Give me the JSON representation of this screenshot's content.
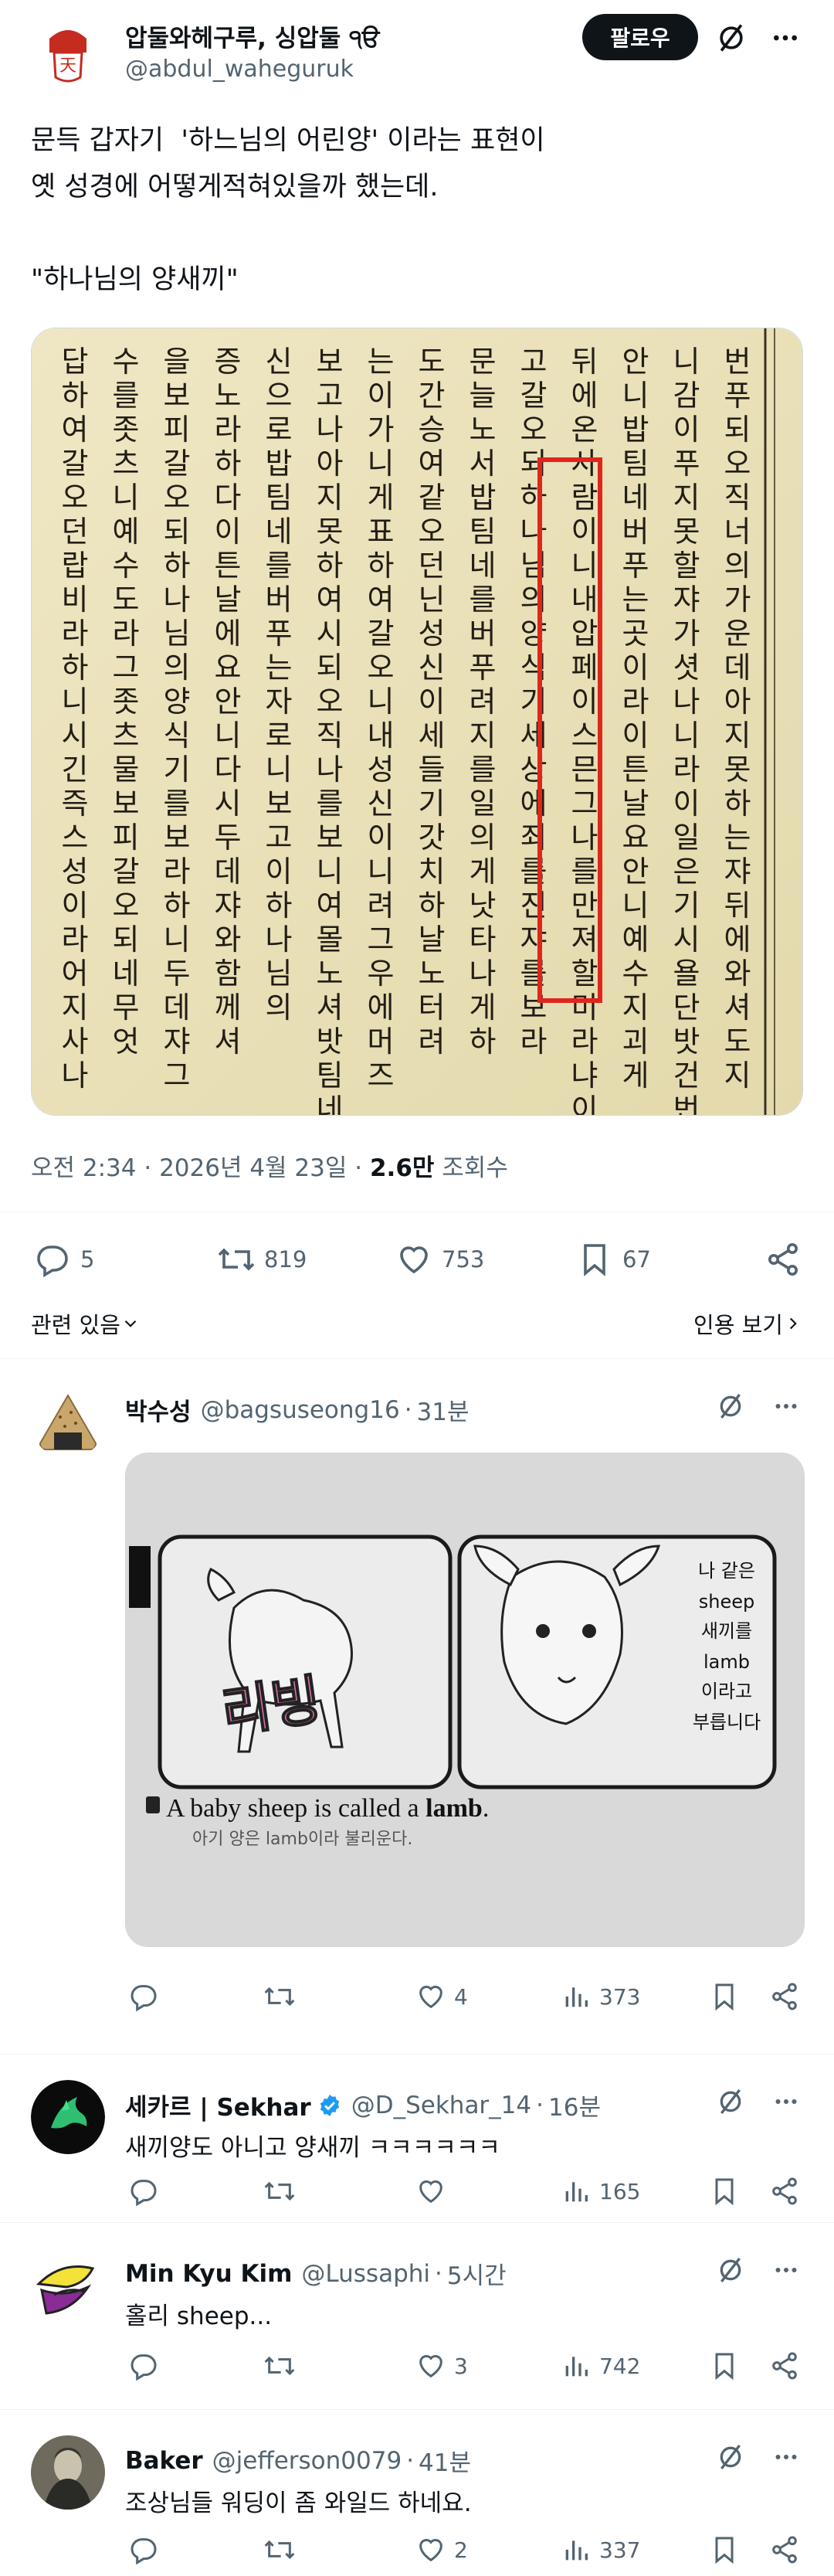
{
  "post": {
    "author_name": "압둘와헤구루, 싱압둘 ੧ੳ",
    "author_handle": "@abdul_waheguruk",
    "follow_label": "팔로우",
    "text": "문득 갑자기  '하느님의 어린양' 이라는 표현이\n옛 성경에 어떻게적혀있을까 했는데.\n\n\"하나님의 양새끼\"",
    "image_caption": "하나님의 양",
    "timestamp": "오전 2:34 · 2026년 4월 23일",
    "views_count": "2.6만",
    "views_label": "조회수",
    "stats": {
      "replies": "5",
      "reposts": "819",
      "likes": "753",
      "bookmarks": "67"
    },
    "related_label": "관련 있음",
    "quotes_label": "인용 보기"
  },
  "replies": [
    {
      "name": "박수성",
      "handle": "@bagsuseong16",
      "time": "31분",
      "text": "",
      "media": {
        "side_label": "리빙",
        "panel_text": [
          "나 같은",
          "sheep",
          "새끼를",
          "lamb",
          "이라고",
          "부릅니다"
        ],
        "caption_en_pre": "A baby sheep is called a ",
        "caption_en_bold": "lamb",
        "caption_en_post": ".",
        "caption_ko": "아기 양은 lamb이라 불리운다."
      },
      "stats": {
        "replies": "",
        "reposts": "",
        "likes": "4",
        "views": "373"
      }
    },
    {
      "name": "세카르 | Sekhar",
      "handle": "@D_Sekhar_14",
      "time": "16분",
      "verified": true,
      "text": "새끼양도 아니고 양새끼 ㅋㅋㅋㅋㅋㅋ",
      "stats": {
        "replies": "",
        "reposts": "",
        "likes": "",
        "views": "165"
      }
    },
    {
      "name": "Min Kyu Kim",
      "handle": "@Lussaphi",
      "time": "5시간",
      "text": "홀리 sheep...",
      "stats": {
        "replies": "",
        "reposts": "",
        "likes": "3",
        "views": "742"
      }
    },
    {
      "name": "Baker",
      "handle": "@jefferson0079",
      "time": "41분",
      "text": "조상님들 워딩이 좀 와일드 하네요.",
      "stats": {
        "replies": "",
        "reposts": "",
        "likes": "2",
        "views": "337"
      }
    }
  ],
  "scan_columns": [
    "번푸되오직너의가운데아지못하는쟈뒤에와셔도지",
    "니감이푸지못할쟈가셧나니라이일은기시욜단밧건번",
    "안니밥팀네버푸는곳이라이튼날요안니예수지괴게",
    "뒤에온사람이니내압페이스믄그나를만져할미라냐이는",
    "고갈오되하나님의양식기세상에죄를진쟈를보라",
    "문늘노서밥팀네를버푸려지를일의게낫타나게하",
    "도간승여같오던닌성신이세들기갓치하날노터려",
    "는이가니게표하여갈오니내성신이니려그우에머즈",
    "보고나아지못하여시되오직나를보니여몰노셔밧팀네",
    "신으로밥팀네를버푸는자로니보고이하나님의",
    "증노라하다이튼날에요안니다시두데쟈와함께셔",
    "을보피갈오되하나님의양식기를보라하니두데쟈그",
    "수를좃츠니예수도라그좃츠물보피갈오되네무엇",
    "답하여갈오던랍비라하니시긴즉스성이라어지사나"
  ],
  "colors": {
    "text_primary": "#0f1419",
    "text_secondary": "#536471",
    "follow_bg": "#0f1419",
    "verified": "#1d9bf0",
    "scan_paper": "#ece3bc",
    "scan_highlight": "#e0261c"
  }
}
